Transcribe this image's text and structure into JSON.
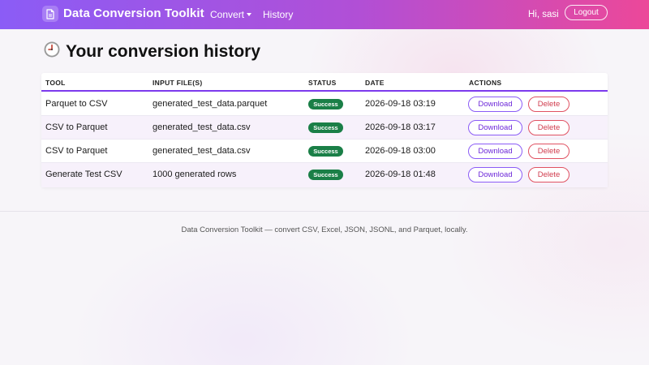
{
  "navbar": {
    "brand": "Data Conversion Toolkit",
    "brand_icon": "file-document-icon",
    "links": [
      {
        "label": "Convert",
        "has_dropdown": true
      },
      {
        "label": "History",
        "has_dropdown": false
      }
    ],
    "greeting": "Hi, sasi",
    "logout_label": "Logout",
    "gradient_colors": [
      "#8b5cf6",
      "#ec4899"
    ]
  },
  "page": {
    "title": "Your conversion history",
    "title_icon": "clock-icon"
  },
  "table": {
    "headers": [
      "TOOL",
      "INPUT FILE(S)",
      "STATUS",
      "DATE",
      "ACTIONS"
    ],
    "rows": [
      {
        "tool": "Parquet to CSV",
        "input": "generated_test_data.parquet",
        "status": "Success",
        "date": "2026-09-18 03:19",
        "download": "Download",
        "delete": "Delete"
      },
      {
        "tool": "CSV to Parquet",
        "input": "generated_test_data.csv",
        "status": "Success",
        "date": "2026-09-18 03:17",
        "download": "Download",
        "delete": "Delete"
      },
      {
        "tool": "CSV to Parquet",
        "input": "generated_test_data.csv",
        "status": "Success",
        "date": "2026-09-18 03:00",
        "download": "Download",
        "delete": "Delete"
      },
      {
        "tool": "Generate Test CSV",
        "input": "1000 generated rows",
        "status": "Success",
        "date": "2026-09-18 01:48",
        "download": "Download",
        "delete": "Delete"
      }
    ],
    "colors": {
      "header_underline": "#7c3aed",
      "success_badge": "#1a7f47",
      "download": "#6d28d9",
      "delete": "#d03b4c"
    }
  },
  "footer": {
    "text": "Data Conversion Toolkit — convert CSV, Excel, JSON, JSONL, and Parquet, locally."
  }
}
